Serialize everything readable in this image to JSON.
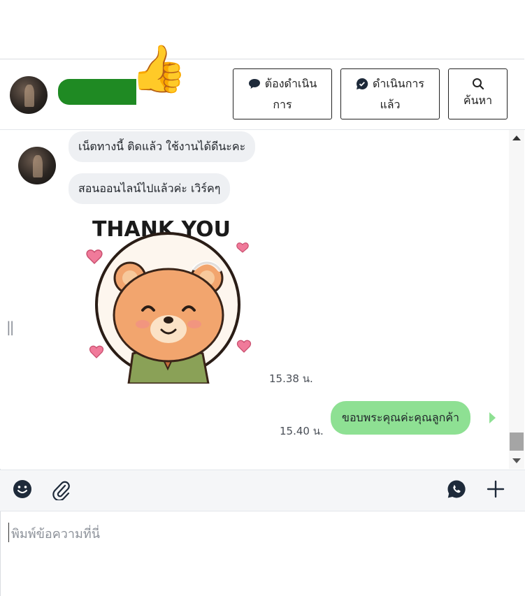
{
  "header": {
    "buttons": {
      "todo": {
        "line1": "ต้องดำเนิน",
        "line2": "การ"
      },
      "done": {
        "line1": "ดำเนินการ",
        "line2": "แล้ว"
      },
      "search": {
        "label": "ค้นหา"
      }
    },
    "redaction_color": "#1f8a23",
    "thumbs_emoji": "👍"
  },
  "messages": [
    {
      "side": "in",
      "text": "เน็ตทางนี้ ติดแล้ว ใช้งานได้ดีนะคะ"
    },
    {
      "side": "in",
      "text": "สอนออนไลน์ไปแล้วค่ะ เวิร์คๆ"
    },
    {
      "side": "in",
      "type": "sticker",
      "sticker_text": "THANK YOU",
      "time": "15.38 น."
    },
    {
      "side": "out",
      "text": "ขอบพระคุณค่ะคุณลูกค้า",
      "time": "15.40 น."
    }
  ],
  "colors": {
    "incoming_bubble": "#eef0f3",
    "outgoing_bubble": "#8ee093",
    "accent_icon": "#1e2a3a"
  },
  "toolbar": {
    "icons": [
      "emoji-icon",
      "attachment-icon",
      "phone-chat-icon",
      "plus-icon"
    ]
  },
  "composer": {
    "placeholder": "พิมพ์ข้อความที่นี่"
  }
}
